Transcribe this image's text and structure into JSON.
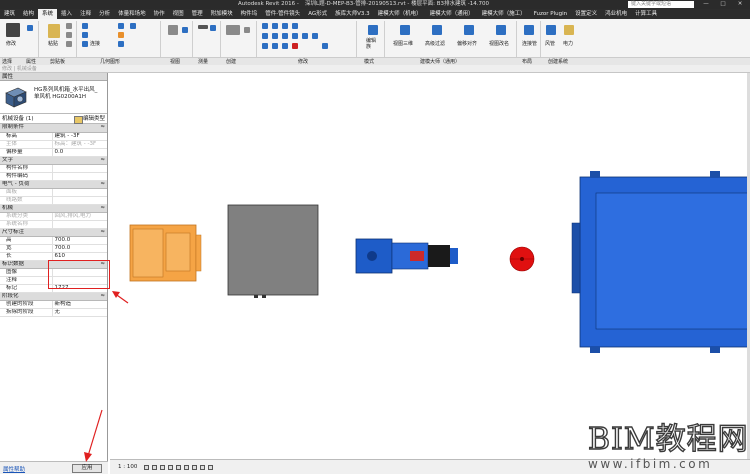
{
  "titlebar": {
    "app_title": "Autodesk Revit 2016 -",
    "file_title": "深圳L题-D-MEP-B3-管排-20190513.rvt - 楼层平面: B3排水建筑 -14.700",
    "search_placeholder": "键入关键字或短语"
  },
  "menu": {
    "items": [
      "建筑",
      "结构",
      "系统",
      "插入",
      "注释",
      "分析",
      "体量和场地",
      "协作",
      "视图",
      "管理",
      "附加模块",
      "构件坞",
      "管件-管件镜头",
      "AG形式",
      "族库大师V3.3",
      "建模大师（机电）",
      "建模大师（通用）",
      "建模大师（施工）",
      "Fuzor Plugin",
      "设置定义",
      "鸿业机电",
      "计算工具"
    ],
    "active_index": 2
  },
  "ribbon": {
    "tool_labels": {
      "modify": "修改",
      "paste": "粘贴",
      "join": "连接",
      "edit_family": "编辑族",
      "viewsettings": "视图三维",
      "advfilter": "高级过滤",
      "align": "偏移对齐",
      "rename": "视图改名",
      "connect": "连接管",
      "duct": "风管",
      "elec": "电力"
    },
    "group_labels": [
      "选择",
      "属性",
      "剪贴板",
      "几何图形",
      "视图",
      "测量",
      "创建",
      "修改",
      "模式",
      "建模大师（通用）",
      "布局",
      "创建系统"
    ]
  },
  "options_bar": {
    "text": "修改 | 机械设备"
  },
  "properties": {
    "palette_title": "属性",
    "type_name": "HG系列风机箱_水平出风_单风机 HG0200A1H",
    "instance_label": "机械设备 (1)",
    "edit_type_label": "编辑类型",
    "rows": [
      {
        "kind": "cat",
        "key": "限制条件",
        "val": "≈"
      },
      {
        "kind": "row",
        "key": "标高",
        "val": "建筑 - -3F"
      },
      {
        "kind": "gray",
        "key": "主体",
        "val": "标高：建筑 - -3F"
      },
      {
        "kind": "row",
        "key": "偏移量",
        "val": "0.0"
      },
      {
        "kind": "cat",
        "key": "文字",
        "val": "≈"
      },
      {
        "kind": "row",
        "key": "构件名称",
        "val": ""
      },
      {
        "kind": "row",
        "key": "构件编码",
        "val": ""
      },
      {
        "kind": "cat",
        "key": "电气 - 负荷",
        "val": "≈"
      },
      {
        "kind": "gray",
        "key": "面板",
        "val": ""
      },
      {
        "kind": "gray",
        "key": "线路数",
        "val": ""
      },
      {
        "kind": "cat",
        "key": "机械",
        "val": "≈"
      },
      {
        "kind": "gray",
        "key": "系统分类",
        "val": "回风,排风,电力"
      },
      {
        "kind": "gray",
        "key": "系统名称",
        "val": ""
      },
      {
        "kind": "cat",
        "key": "尺寸标注",
        "val": "≈"
      },
      {
        "kind": "row",
        "key": "高",
        "val": "700.0"
      },
      {
        "kind": "row",
        "key": "宽",
        "val": "700.0"
      },
      {
        "kind": "row",
        "key": "长",
        "val": "610"
      },
      {
        "kind": "cat",
        "key": "标识数据",
        "val": "≈"
      },
      {
        "kind": "row",
        "key": "图像",
        "val": ""
      },
      {
        "kind": "row",
        "key": "注释",
        "val": ""
      },
      {
        "kind": "row",
        "key": "标记",
        "val": "1727"
      },
      {
        "kind": "cat",
        "key": "阶段化",
        "val": "≈"
      },
      {
        "kind": "row",
        "key": "创建的阶段",
        "val": "新构造"
      },
      {
        "kind": "row",
        "key": "拆除的阶段",
        "val": "无"
      }
    ],
    "help_link": "属性帮助",
    "apply_button": "应用"
  },
  "statusbar": {
    "scale": "1 : 100"
  },
  "watermark": {
    "brand": "BIM教程网",
    "url": "www.ifbim.com"
  },
  "colors": {
    "accent_blue": "#2d6fc2",
    "fan_box_orange": "#f5a445",
    "unit_gray": "#808080",
    "pump_blue": "#1e5cc8",
    "hydrant_red": "#e01010",
    "highlight_red": "#e02020"
  }
}
